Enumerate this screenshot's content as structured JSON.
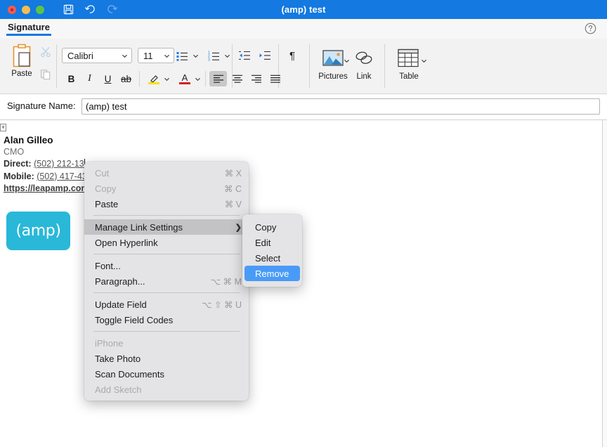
{
  "window": {
    "title": "(amp) test",
    "titlebar_color": "#1479e0",
    "buttons": [
      {
        "name": "close",
        "color": "#ef5d52"
      },
      {
        "name": "minimize",
        "color": "#f5bd4f"
      },
      {
        "name": "maximize",
        "color": "#5cc443"
      }
    ],
    "quick_actions": [
      {
        "name": "save",
        "label": "Save",
        "enabled": true
      },
      {
        "name": "undo",
        "label": "Undo",
        "enabled": true
      },
      {
        "name": "redo",
        "label": "Redo",
        "enabled": false
      }
    ]
  },
  "tabstrip": {
    "active_tab": "Signature",
    "accent": "#1479e0",
    "help_label": "Help"
  },
  "ribbon": {
    "paste": {
      "label": "Paste",
      "cut_label": "Cut",
      "copy_label": "Copy"
    },
    "font": {
      "family": "Calibri",
      "size": "11"
    },
    "buttons": {
      "bullets": "Bullets",
      "numbering": "Numbering",
      "decrease_indent": "Decrease Indent",
      "increase_indent": "Increase Indent",
      "show_marks": "¶",
      "bold": "B",
      "italic": "I",
      "underline": "U",
      "strikethrough": "ab",
      "highlight": "Text Highlight Color",
      "fontcolor": "Font Color",
      "align_left": "Align Left",
      "align_center": "Center",
      "align_right": "Align Right",
      "justify": "Justify"
    },
    "insert": [
      {
        "label": "Pictures",
        "has_chevron": true
      },
      {
        "label": "Link",
        "has_chevron": false
      },
      {
        "label": "Table",
        "has_chevron": true
      }
    ],
    "highlight_color": "#f5e400",
    "fontcolor_color": "#d81f1f"
  },
  "signature_name": {
    "label": "Signature Name:",
    "value": "(amp) test",
    "placeholder": "Signature Name"
  },
  "signature_body": {
    "name": "Alan Gilleo",
    "title": "CMO",
    "direct_label": "Direct:",
    "direct_value": "(502) 212-13",
    "mobile_label": "Mobile:",
    "mobile_value": "(502) 417-43",
    "url": "https://leapamp.com",
    "logo_text": "(amp)",
    "logo_color": "#29b8d8"
  },
  "context_menu": {
    "items": [
      {
        "label": "Cut",
        "shortcut": "⌘ X",
        "disabled": true,
        "separator_after": false
      },
      {
        "label": "Copy",
        "shortcut": "⌘ C",
        "disabled": true,
        "separator_after": false
      },
      {
        "label": "Paste",
        "shortcut": "⌘ V",
        "disabled": false,
        "separator_after": true
      },
      {
        "label": "Manage Link Settings",
        "shortcut": "",
        "disabled": false,
        "highlighted": true,
        "submenu": true,
        "separator_after": false
      },
      {
        "label": "Open Hyperlink",
        "shortcut": "",
        "disabled": false,
        "separator_after": true
      },
      {
        "label": "Font...",
        "shortcut": "",
        "disabled": false,
        "separator_after": false
      },
      {
        "label": "Paragraph...",
        "shortcut": "⌥ ⌘ M",
        "disabled": false,
        "separator_after": true
      },
      {
        "label": "Update Field",
        "shortcut": "⌥ ⇧ ⌘ U",
        "disabled": false,
        "separator_after": false
      },
      {
        "label": "Toggle Field Codes",
        "shortcut": "",
        "disabled": false,
        "separator_after": true
      },
      {
        "label": "iPhone",
        "shortcut": "",
        "disabled": true,
        "separator_after": false
      },
      {
        "label": "Take Photo",
        "shortcut": "",
        "disabled": false,
        "separator_after": false
      },
      {
        "label": "Scan Documents",
        "shortcut": "",
        "disabled": false,
        "separator_after": false
      },
      {
        "label": "Add Sketch",
        "shortcut": "",
        "disabled": true,
        "separator_after": false
      }
    ]
  },
  "submenu": {
    "selected": "Remove",
    "selection_color": "#4a9bf7",
    "items": [
      {
        "label": "Copy",
        "selected": false
      },
      {
        "label": "Edit",
        "selected": false
      },
      {
        "label": "Select",
        "selected": false
      },
      {
        "label": "Remove",
        "selected": true
      }
    ]
  }
}
